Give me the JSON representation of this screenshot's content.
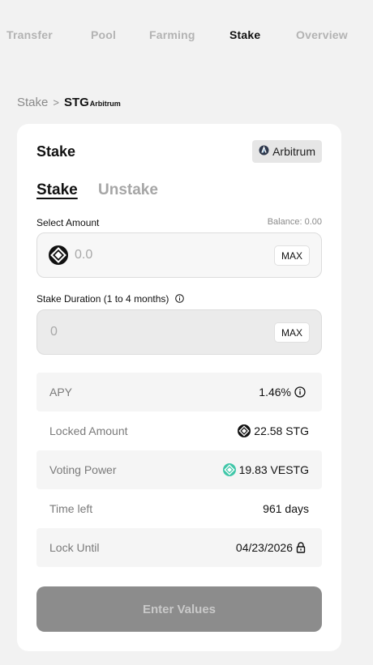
{
  "nav": {
    "items": [
      {
        "label": "Transfer",
        "active": false
      },
      {
        "label": "Pool",
        "active": false
      },
      {
        "label": "Farming",
        "active": false
      },
      {
        "label": "Stake",
        "active": true
      },
      {
        "label": "Overview",
        "active": false
      }
    ]
  },
  "breadcrumb": {
    "parent": "Stake",
    "separator": ">",
    "token": "STG",
    "chain": "Arbitrum"
  },
  "card": {
    "title": "Stake",
    "chain_badge": "Arbitrum",
    "tabs": [
      {
        "label": "Stake",
        "active": true
      },
      {
        "label": "Unstake",
        "active": false
      }
    ],
    "amount": {
      "label": "Select Amount",
      "balance": "Balance: 0.00",
      "placeholder": "0.0",
      "max_label": "MAX",
      "token_icon": "stg-token-icon"
    },
    "duration": {
      "label": "Stake Duration (1 to 4 months)",
      "placeholder": "0",
      "max_label": "MAX"
    },
    "stats": [
      {
        "label": "APY",
        "value": "1.46%",
        "icon": "info-icon"
      },
      {
        "label": "Locked Amount",
        "value": "22.58 STG",
        "icon": "stg-token-icon"
      },
      {
        "label": "Voting Power",
        "value": "19.83 VESTG",
        "icon": "vestg-token-icon"
      },
      {
        "label": "Time left",
        "value": "961 days",
        "icon": ""
      },
      {
        "label": "Lock Until",
        "value": "04/23/2026",
        "icon": "lock-icon"
      }
    ],
    "submit_label": "Enter Values"
  },
  "colors": {
    "background": "#f2f2f2",
    "card": "#ffffff",
    "vestg_accent": "#3fc6a8",
    "submit_disabled": "#8c8c8c"
  }
}
